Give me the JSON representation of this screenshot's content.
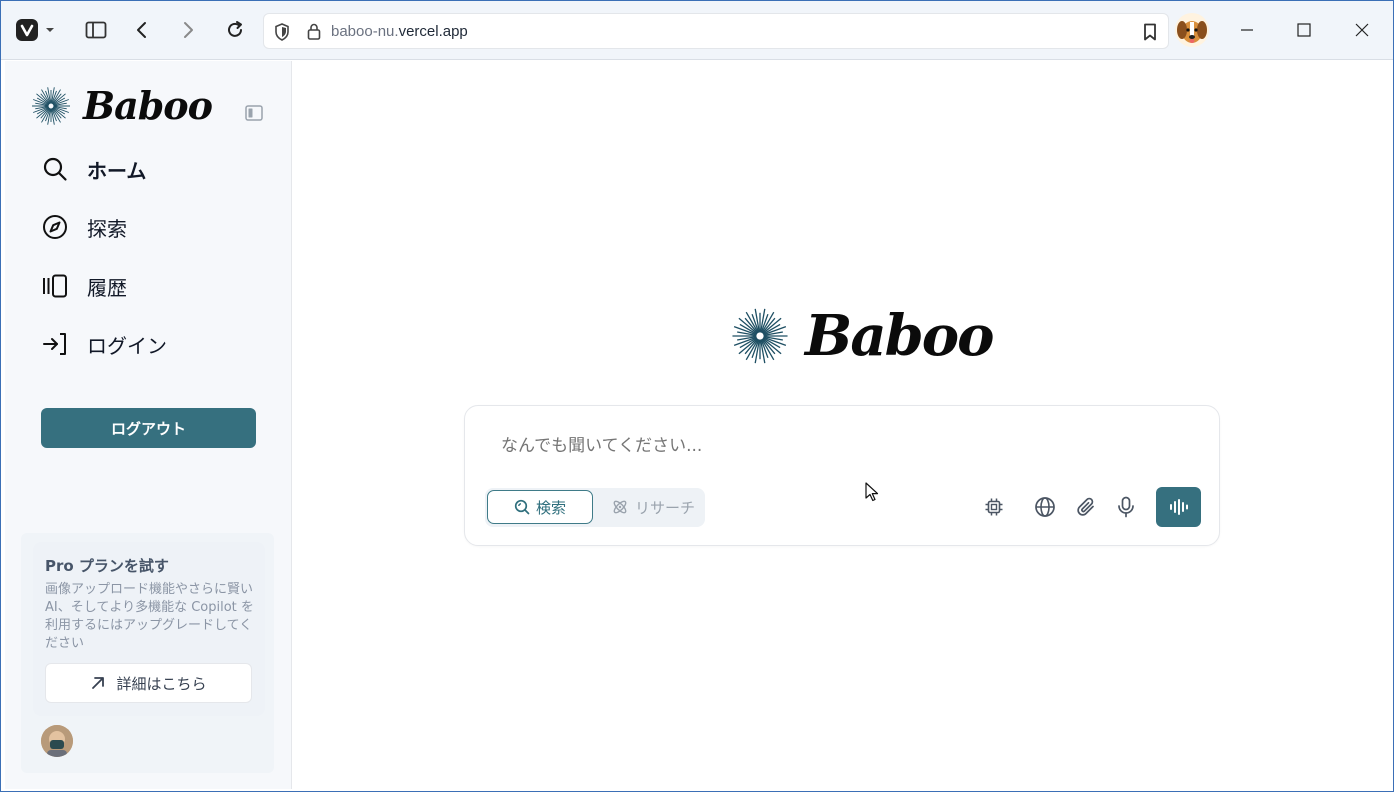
{
  "browser": {
    "url_prefix": "baboo-nu.",
    "url_host": "vercel.app"
  },
  "sidebar": {
    "brand": "Baboo",
    "nav": [
      {
        "label": "ホーム",
        "icon": "search-icon"
      },
      {
        "label": "探索",
        "icon": "compass-icon"
      },
      {
        "label": "履歴",
        "icon": "history-icon"
      },
      {
        "label": "ログイン",
        "icon": "login-icon"
      }
    ],
    "logout_label": "ログアウト",
    "pro": {
      "title": "Pro プランを試す",
      "description": "画像アップロード機能やさらに賢い AI、そしてより多機能な Copilot を利用するにはアップグレードしてください",
      "button_label": "詳細はこちら"
    }
  },
  "main": {
    "brand": "Baboo",
    "composer": {
      "placeholder": "なんでも聞いてください...",
      "modes": [
        {
          "label": "検索",
          "selected": true
        },
        {
          "label": "リサーチ",
          "selected": false
        }
      ]
    }
  },
  "colors": {
    "accent": "#36707f",
    "brand_star": "#1e4f63"
  }
}
